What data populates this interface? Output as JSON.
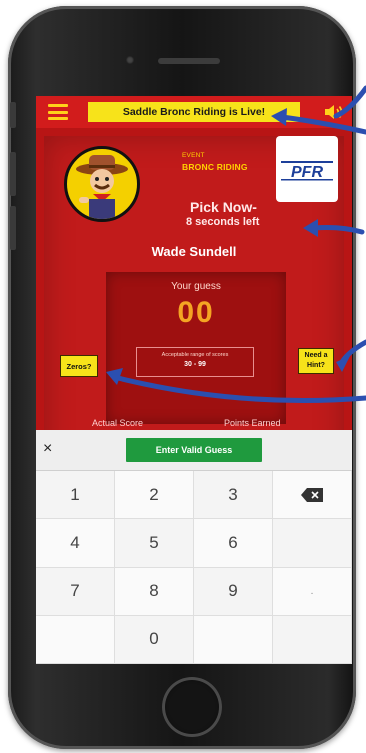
{
  "app": {
    "live_banner": "Saddle Bronc Riding is Live!",
    "event_small": "EVENT",
    "event_name": "BRONC RIDING",
    "logo_text": "PFR",
    "pick_now": "Pick Now-",
    "seconds_left": "8 seconds left",
    "rider_name": "Wade Sundell",
    "your_guess_label": "Your guess",
    "guess_value": "00",
    "range_label": "Acceptable range of scores",
    "range_value": "30 - 99",
    "zeros_button": "Zeros?",
    "hint_button": "Need a Hint?",
    "actual_score_label": "Actual Score",
    "points_earned_label": "Points Earned",
    "close_symbol": "×",
    "enter_button": "Enter Valid Guess"
  },
  "keypad": {
    "k1": "1",
    "k2": "2",
    "k3": "3",
    "k4": "4",
    "k5": "5",
    "k6": "6",
    "k7": "7",
    "k8": "8",
    "k9": "9",
    "k0": "0",
    "dot": "."
  },
  "colors": {
    "screen_red": "#b81515",
    "banner_yellow": "#f7e31a",
    "guess_orange": "#f4a423",
    "enter_green": "#1f9a3e",
    "arrow_blue": "#2b4fb0"
  }
}
